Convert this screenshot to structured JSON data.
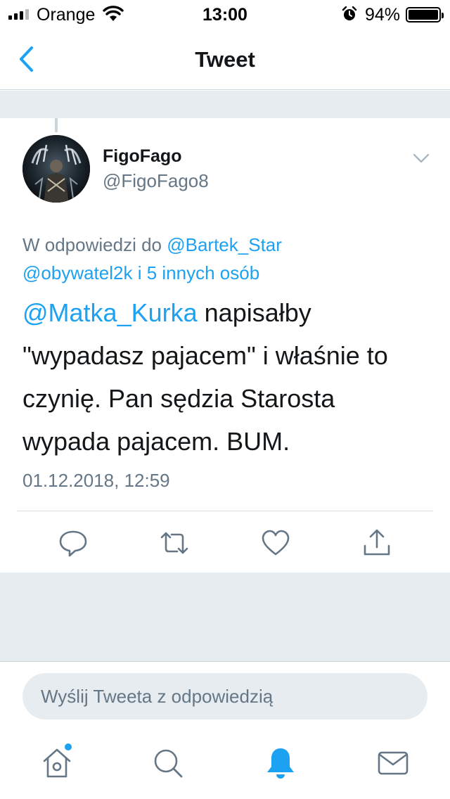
{
  "status_bar": {
    "carrier": "Orange",
    "time": "13:00",
    "battery_percent": "94%",
    "battery_level": 0.94,
    "signal_bars": 3,
    "icons": [
      "signal-icon",
      "wifi-icon",
      "alarm-icon",
      "battery-icon"
    ]
  },
  "nav": {
    "title": "Tweet",
    "back_icon": "chevron-left-icon"
  },
  "tweet": {
    "author": {
      "display_name": "FigoFago",
      "handle": "@FigoFago8"
    },
    "reply_context": {
      "prefix": "W odpowiedzi do ",
      "user1": "@Bartek_Star",
      "user2": "@obywatel2k",
      "suffix": " i 5 innych osób"
    },
    "mention": "@Matka_Kurka",
    "text_line1": " napisałby",
    "text_line2": "\"wypadasz pajacem\" i właśnie to",
    "text_line3": "czynię. Pan sędzia Starosta",
    "text_line4": "wypada pajacem. BUM.",
    "timestamp": "01.12.2018, 12:59",
    "actions": [
      "reply-icon",
      "retweet-icon",
      "like-icon",
      "share-icon"
    ]
  },
  "composer": {
    "placeholder": "Wyślij Tweeta z odpowiedzią"
  },
  "tab_bar": {
    "tabs": [
      "home-icon",
      "search-icon",
      "notifications-icon",
      "messages-icon"
    ],
    "active": "notifications-icon"
  },
  "colors": {
    "accent": "#1da1f2",
    "secondary_text": "#657786",
    "separator_band": "#e6ecf0"
  }
}
